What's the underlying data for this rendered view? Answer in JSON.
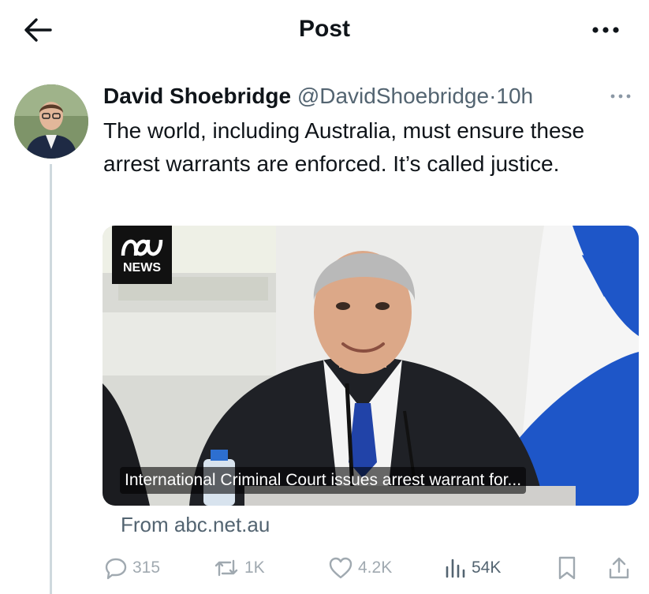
{
  "header": {
    "title": "Post"
  },
  "tweet": {
    "author_name": "David Shoebridge",
    "author_handle": "@DavidShoebridge",
    "separator": "·",
    "time": "10h",
    "text": "The world, including Australia, must ensure these arrest warrants are enforced. It’s called justice.",
    "card": {
      "publisher_logo_text": "NEWS",
      "headline": "International Criminal Court issues arrest warrant for...",
      "source": "From abc.net.au"
    },
    "actions": {
      "replies": "315",
      "reposts": "1K",
      "likes": "4.2K",
      "views": "54K"
    }
  },
  "colors": {
    "text": "#0f1419",
    "secondary": "#536471",
    "line": "#cfd9de",
    "flag_blue": "#1e56c8"
  },
  "icons": [
    "back-arrow-icon",
    "more-icon",
    "reply-icon",
    "repost-icon",
    "like-icon",
    "views-icon",
    "bookmark-icon",
    "share-icon"
  ]
}
